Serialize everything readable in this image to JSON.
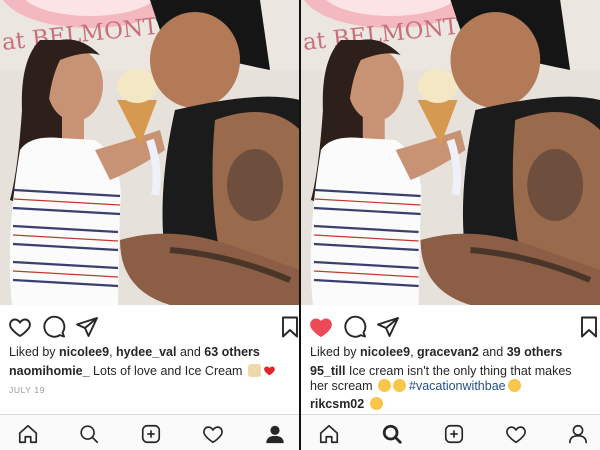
{
  "sign_text": "at BELMONT P",
  "left": {
    "likes": {
      "prefix": "Liked by ",
      "user1": "nicolee9",
      "sep": ", ",
      "user2": "hydee_val",
      "mid": " and ",
      "others": "63 others"
    },
    "caption": {
      "user": "naomihomie_",
      "text": " Lots of love and Ice Cream "
    },
    "date": "JULY 19",
    "liked": false,
    "active_tab": "profile"
  },
  "right": {
    "likes": {
      "prefix": "Liked by ",
      "user1": "nicolee9",
      "sep": ", ",
      "user2": "gracevan2",
      "mid": " and ",
      "others": "39 others"
    },
    "caption": {
      "user": "95_till",
      "text": " Ice cream isn't the only thing that makes her scream ",
      "hashtag": "#vacationwithbae"
    },
    "comment": {
      "user": "rikcsm02"
    },
    "liked": true,
    "active_tab": "search"
  },
  "colors": {
    "like_red": "#ed4956",
    "text": "#262626",
    "hashtag": "#1f4f8b",
    "muted": "#999999"
  },
  "icons": [
    "heart-icon",
    "comment-icon",
    "share-icon",
    "bookmark-icon",
    "home-icon",
    "search-icon",
    "add-post-icon",
    "activity-icon",
    "profile-icon"
  ]
}
